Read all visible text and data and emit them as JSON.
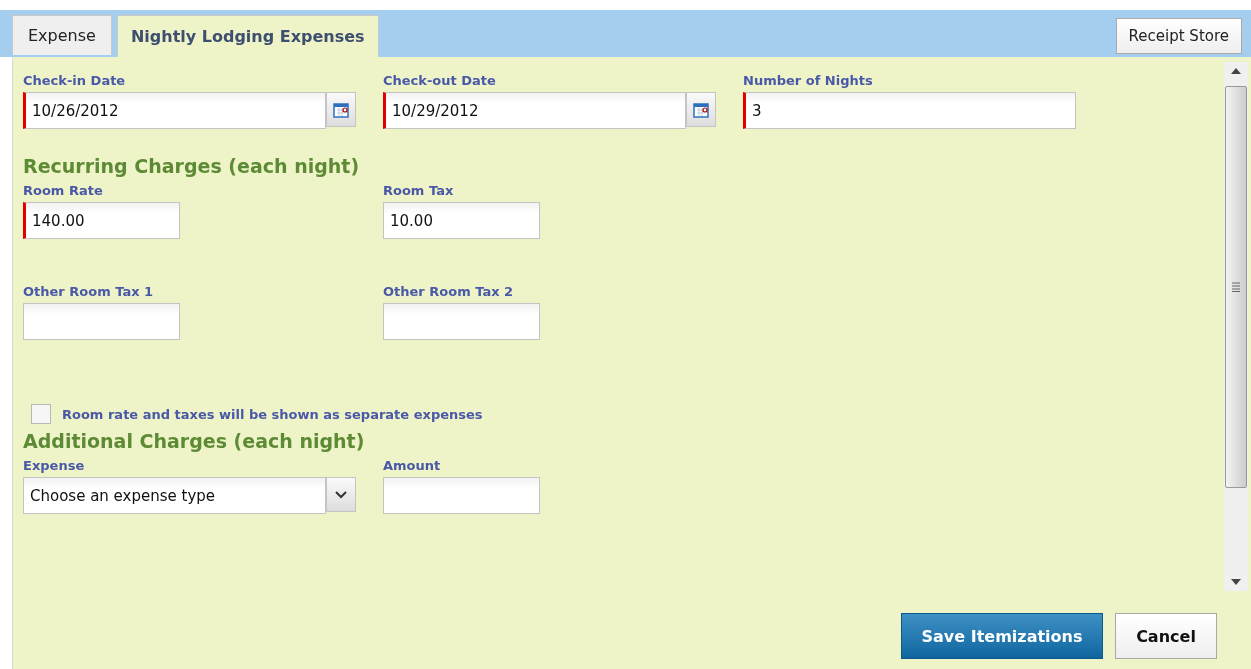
{
  "tabs": [
    {
      "label": "Expense",
      "selected": false
    },
    {
      "label": "Nightly Lodging Expenses",
      "selected": true
    }
  ],
  "receipt_store_button": "Receipt Store",
  "stay_fields": [
    {
      "kind": "date",
      "label": "Check-in Date",
      "value": "10/26/2012",
      "required": true
    },
    {
      "kind": "date",
      "label": "Check-out Date",
      "value": "10/29/2012",
      "required": true
    },
    {
      "kind": "wide",
      "label": "Number of Nights",
      "value": "3",
      "required": true
    }
  ],
  "recurring": {
    "heading": "Recurring Charges (each night)",
    "fields": [
      {
        "kind": "small",
        "label": "Room Rate",
        "value": "140.00",
        "required": true
      },
      {
        "kind": "small",
        "label": "Room Tax",
        "value": "10.00",
        "required": false
      },
      {
        "kind": "small",
        "label": "Other Room Tax 1",
        "required": false
      },
      {
        "kind": "small",
        "label": "Other Room Tax 2",
        "required": false
      }
    ]
  },
  "separate_expenses": {
    "label": "Room rate and taxes will be shown as separate expenses",
    "checked": false
  },
  "additional": {
    "heading": "Additional Charges (each night)",
    "fields": [
      {
        "kind": "select",
        "label": "Expense",
        "value": "Choose an expense type",
        "required": false
      },
      {
        "kind": "small",
        "label": "Amount",
        "required": false
      }
    ]
  },
  "buttons": [
    {
      "kind": "primary",
      "label": "Save Itemizations"
    },
    {
      "kind": "secondary",
      "label": "Cancel"
    }
  ]
}
